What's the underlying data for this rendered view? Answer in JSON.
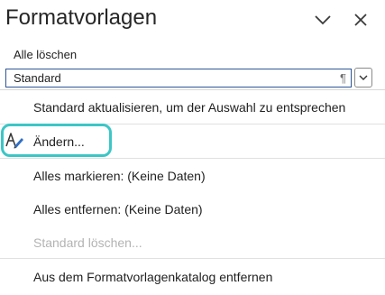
{
  "pane": {
    "title": "Formatvorlagen",
    "options_icon": "chevron-down-icon",
    "close_icon": "close-icon"
  },
  "clear_all_label": "Alle löschen",
  "style_select": {
    "value": "Standard",
    "paragraph_mark": "¶"
  },
  "context_menu": {
    "items": [
      {
        "label": "Standard aktualisieren, um der Auswahl zu entsprechen",
        "enabled": true
      },
      {
        "label": "Ändern...",
        "enabled": true,
        "icon": "modify-style-icon",
        "highlighted": true
      },
      {
        "label": "Alles markieren: (Keine Daten)",
        "enabled": true
      },
      {
        "label": "Alles entfernen: (Keine Daten)",
        "enabled": true
      },
      {
        "label": "Standard löschen...",
        "enabled": false
      },
      {
        "label": "Aus dem Formatvorlagenkatalog entfernen",
        "enabled": true
      }
    ]
  },
  "colors": {
    "highlight_ring": "#3cc6c6",
    "input_border": "#2f5597",
    "disabled_text": "#b3b3b3"
  }
}
